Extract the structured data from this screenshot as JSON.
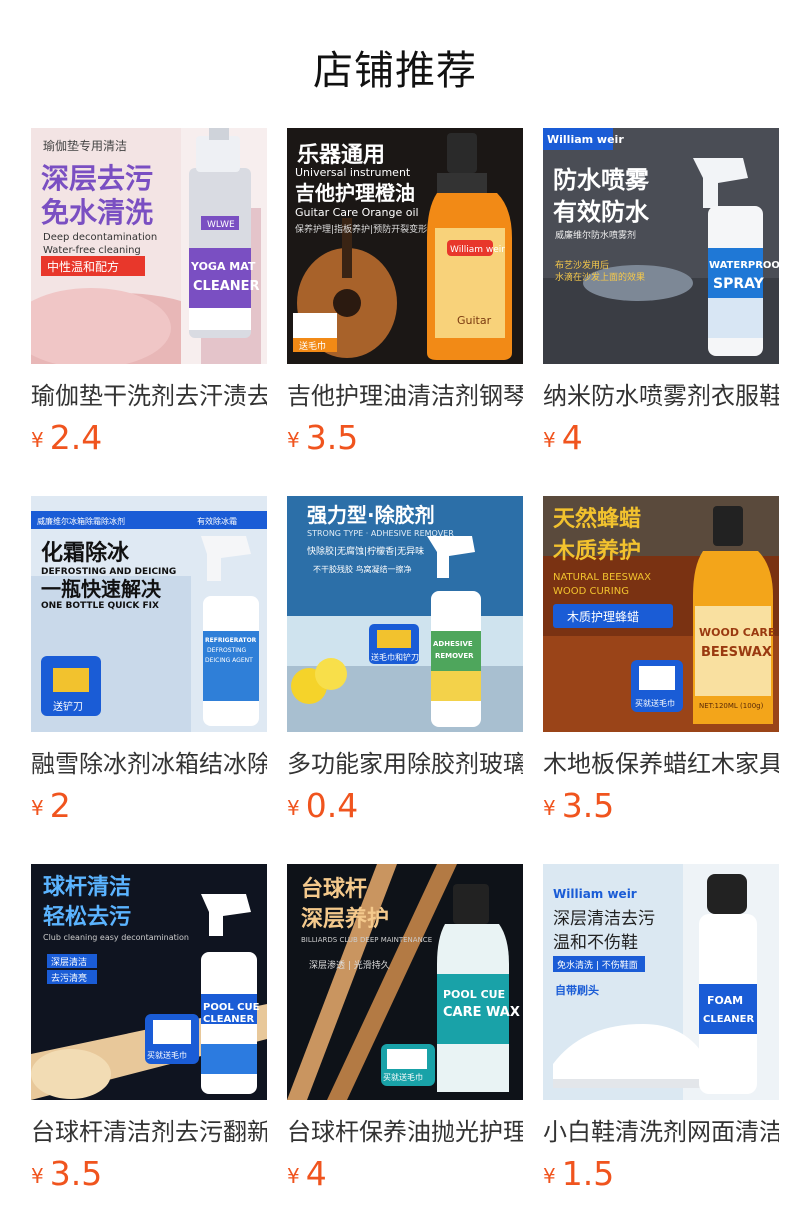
{
  "section_title": "店铺推荐",
  "currency_symbol": "¥",
  "products": [
    {
      "name": "瑜伽垫干洗剂去汗渍去污",
      "price": "2.4",
      "image_text": [
        "瑜伽垫专用清洁",
        "深层去污",
        "免水清洗",
        "Deep decontamination",
        "Water-free cleaning",
        "中性温和配方",
        "WLWE",
        "YOGA MAT",
        "CLEANER"
      ]
    },
    {
      "name": "吉他护理油清洁剂钢琴",
      "price": "3.5",
      "image_text": [
        "乐器通用",
        "Universal instrument",
        "吉他护理橙油",
        "Guitar Care Orange oil",
        "保养护理|指板养护|预防开裂变形",
        "送毛巾",
        "William weir",
        "Guitar"
      ]
    },
    {
      "name": "纳米防水喷雾剂衣服鞋",
      "price": "4",
      "image_text": [
        "William weir",
        "防水喷雾",
        "有效防水",
        "威廉维尔防水喷雾剂",
        "布艺沙发用后",
        "水滴在沙发上面的效果",
        "WATERPROOF",
        "SPRAY"
      ]
    },
    {
      "name": "融雪除冰剂冰箱结冰除霜",
      "price": "2",
      "image_text": [
        "威廉维尔冰箱除霜除冰剂",
        "有效除冰霜",
        "化霜除冰",
        "DEFROSTING AND DEICING",
        "一瓶快速解决",
        "ONE BOTTLE QUICK FIX",
        "送铲刀",
        "REFRIGERATOR",
        "DEFROSTING",
        "DEICING AGENT"
      ]
    },
    {
      "name": "多功能家用除胶剂玻璃",
      "price": "0.4",
      "image_text": [
        "强力型·除胶剂",
        "STRONG TYPE · ADHESIVE REMOVER",
        "快除胶|无腐蚀|柠檬香|无异味",
        "不干胶残胶 鸟窝凝结一擦净",
        "送毛巾和铲刀",
        "ADHESIVE",
        "REMOVER"
      ]
    },
    {
      "name": "木地板保养蜡红木家具",
      "price": "3.5",
      "image_text": [
        "天然蜂蜡",
        "木质养护",
        "NATURAL BEESWAX",
        "WOOD CURING",
        "木质护理蜂蜡",
        "买就送毛巾",
        "WOOD CARE",
        "BEESWAX",
        "NET:120ML (100g)"
      ]
    },
    {
      "name": "台球杆清洁剂去污翻新",
      "price": "3.5",
      "image_text": [
        "球杆清洁",
        "轻松去污",
        "Club cleaning easy decontamination",
        "深层清洁",
        "去污清亮",
        "买就送毛巾",
        "POOL CUE",
        "CLEANER"
      ]
    },
    {
      "name": "台球杆保养油抛光护理",
      "price": "4",
      "image_text": [
        "台球杆",
        "深层养护",
        "BILLIARDS CLUB DEEP MAINTENANCE",
        "深层渗透 | 光滑持久",
        "买就送毛巾",
        "POOL CUE",
        "CARE WAX"
      ]
    },
    {
      "name": "小白鞋清洗剂网面清洁",
      "price": "1.5",
      "image_text": [
        "William weir",
        "深层清洁去污",
        "温和不伤鞋",
        "免水清洗 | 不伤鞋面",
        "自带刷头",
        "FOAM",
        "CLEANER"
      ]
    }
  ],
  "colors": {
    "price": "#f0541e",
    "purple_banner": "#7a4fc2",
    "brand_blue": "#1a5cd6",
    "orange_bottle": "#f28a16",
    "red_label": "#e8372b"
  }
}
